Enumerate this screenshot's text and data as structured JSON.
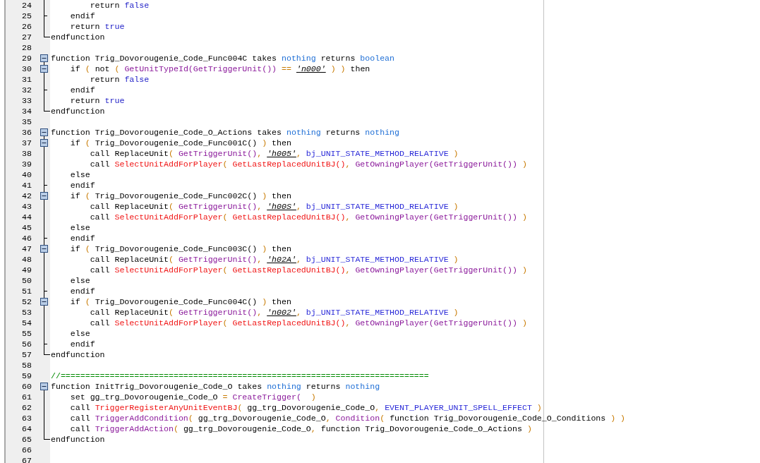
{
  "editor": {
    "lines": [
      {
        "number": "24",
        "kind": "line",
        "tokens": [
          {
            "kind": "plain",
            "text": "        return "
          },
          {
            "kind": "value",
            "text": "false"
          }
        ]
      },
      {
        "number": "25",
        "kind": "branch",
        "tokens": [
          {
            "kind": "plain",
            "text": "    endif"
          }
        ]
      },
      {
        "number": "26",
        "kind": "line",
        "tokens": [
          {
            "kind": "plain",
            "text": "    return "
          },
          {
            "kind": "value",
            "text": "true"
          }
        ]
      },
      {
        "number": "27",
        "kind": "end",
        "tokens": [
          {
            "kind": "plain",
            "text": "endfunction"
          }
        ]
      },
      {
        "number": "28",
        "kind": "none"
      },
      {
        "number": "29",
        "kind": "box",
        "tokens": [
          {
            "kind": "plain",
            "text": "function Trig_Dovorougenie_Code_Func004C takes "
          },
          {
            "kind": "type",
            "text": "nothing"
          },
          {
            "kind": "plain",
            "text": " returns "
          },
          {
            "kind": "type",
            "text": "boolean"
          }
        ]
      },
      {
        "number": "30",
        "kind": "box",
        "tokens": [
          {
            "kind": "plain",
            "text": "    if "
          },
          {
            "kind": "op",
            "text": "( "
          },
          {
            "kind": "plain",
            "text": "not "
          },
          {
            "kind": "op",
            "text": "( "
          },
          {
            "kind": "native",
            "text": "GetUnitTypeId(GetTriggerUnit())"
          },
          {
            "kind": "op",
            "text": " == "
          },
          {
            "kind": "str",
            "text": "'n000'"
          },
          {
            "kind": "op",
            "text": " ) )"
          },
          {
            "kind": "plain",
            "text": " then"
          }
        ]
      },
      {
        "number": "31",
        "kind": "line",
        "tokens": [
          {
            "kind": "plain",
            "text": "        return "
          },
          {
            "kind": "value",
            "text": "false"
          }
        ]
      },
      {
        "number": "32",
        "kind": "branch",
        "tokens": [
          {
            "kind": "plain",
            "text": "    endif"
          }
        ]
      },
      {
        "number": "33",
        "kind": "line",
        "tokens": [
          {
            "kind": "plain",
            "text": "    return "
          },
          {
            "kind": "value",
            "text": "true"
          }
        ]
      },
      {
        "number": "34",
        "kind": "end",
        "tokens": [
          {
            "kind": "plain",
            "text": "endfunction"
          }
        ]
      },
      {
        "number": "35",
        "kind": "none"
      },
      {
        "number": "36",
        "kind": "box",
        "tokens": [
          {
            "kind": "plain",
            "text": "function Trig_Dovorougenie_Code_O_Actions takes "
          },
          {
            "kind": "type",
            "text": "nothing"
          },
          {
            "kind": "plain",
            "text": " returns "
          },
          {
            "kind": "type",
            "text": "nothing"
          }
        ]
      },
      {
        "number": "37",
        "kind": "box",
        "tokens": [
          {
            "kind": "plain",
            "text": "    if "
          },
          {
            "kind": "op",
            "text": "( "
          },
          {
            "kind": "plain",
            "text": "Trig_Dovorougenie_Code_Func001C()"
          },
          {
            "kind": "op",
            "text": " )"
          },
          {
            "kind": "plain",
            "text": " then"
          }
        ]
      },
      {
        "number": "38",
        "kind": "line",
        "tokens": [
          {
            "kind": "plain",
            "text": "        call ReplaceUnit"
          },
          {
            "kind": "op",
            "text": "( "
          },
          {
            "kind": "native",
            "text": "GetTriggerUnit()"
          },
          {
            "kind": "op",
            "text": ", "
          },
          {
            "kind": "str",
            "text": "'h005'"
          },
          {
            "kind": "op",
            "text": ", "
          },
          {
            "kind": "const",
            "text": "bj_UNIT_STATE_METHOD_RELATIVE"
          },
          {
            "kind": "op",
            "text": " )"
          }
        ]
      },
      {
        "number": "39",
        "kind": "line",
        "tokens": [
          {
            "kind": "plain",
            "text": "        call "
          },
          {
            "kind": "bj",
            "text": "SelectUnitAddForPlayer"
          },
          {
            "kind": "op",
            "text": "( "
          },
          {
            "kind": "bj",
            "text": "GetLastReplacedUnitBJ()"
          },
          {
            "kind": "op",
            "text": ", "
          },
          {
            "kind": "native",
            "text": "GetOwningPlayer(GetTriggerUnit())"
          },
          {
            "kind": "op",
            "text": " )"
          }
        ]
      },
      {
        "number": "40",
        "kind": "line",
        "tokens": [
          {
            "kind": "plain",
            "text": "    else"
          }
        ]
      },
      {
        "number": "41",
        "kind": "branch",
        "tokens": [
          {
            "kind": "plain",
            "text": "    endif"
          }
        ]
      },
      {
        "number": "42",
        "kind": "box",
        "tokens": [
          {
            "kind": "plain",
            "text": "    if "
          },
          {
            "kind": "op",
            "text": "( "
          },
          {
            "kind": "plain",
            "text": "Trig_Dovorougenie_Code_Func002C()"
          },
          {
            "kind": "op",
            "text": " )"
          },
          {
            "kind": "plain",
            "text": " then"
          }
        ]
      },
      {
        "number": "43",
        "kind": "line",
        "tokens": [
          {
            "kind": "plain",
            "text": "        call ReplaceUnit"
          },
          {
            "kind": "op",
            "text": "( "
          },
          {
            "kind": "native",
            "text": "GetTriggerUnit()"
          },
          {
            "kind": "op",
            "text": ", "
          },
          {
            "kind": "str",
            "text": "'h00S'"
          },
          {
            "kind": "op",
            "text": ", "
          },
          {
            "kind": "const",
            "text": "bj_UNIT_STATE_METHOD_RELATIVE"
          },
          {
            "kind": "op",
            "text": " )"
          }
        ]
      },
      {
        "number": "44",
        "kind": "line",
        "tokens": [
          {
            "kind": "plain",
            "text": "        call "
          },
          {
            "kind": "bj",
            "text": "SelectUnitAddForPlayer"
          },
          {
            "kind": "op",
            "text": "( "
          },
          {
            "kind": "bj",
            "text": "GetLastReplacedUnitBJ()"
          },
          {
            "kind": "op",
            "text": ", "
          },
          {
            "kind": "native",
            "text": "GetOwningPlayer(GetTriggerUnit())"
          },
          {
            "kind": "op",
            "text": " )"
          }
        ]
      },
      {
        "number": "45",
        "kind": "line",
        "tokens": [
          {
            "kind": "plain",
            "text": "    else"
          }
        ]
      },
      {
        "number": "46",
        "kind": "branch",
        "tokens": [
          {
            "kind": "plain",
            "text": "    endif"
          }
        ]
      },
      {
        "number": "47",
        "kind": "box",
        "tokens": [
          {
            "kind": "plain",
            "text": "    if "
          },
          {
            "kind": "op",
            "text": "( "
          },
          {
            "kind": "plain",
            "text": "Trig_Dovorougenie_Code_Func003C()"
          },
          {
            "kind": "op",
            "text": " )"
          },
          {
            "kind": "plain",
            "text": " then"
          }
        ]
      },
      {
        "number": "48",
        "kind": "line",
        "tokens": [
          {
            "kind": "plain",
            "text": "        call ReplaceUnit"
          },
          {
            "kind": "op",
            "text": "( "
          },
          {
            "kind": "native",
            "text": "GetTriggerUnit()"
          },
          {
            "kind": "op",
            "text": ", "
          },
          {
            "kind": "str",
            "text": "'h02A'"
          },
          {
            "kind": "op",
            "text": ", "
          },
          {
            "kind": "const",
            "text": "bj_UNIT_STATE_METHOD_RELATIVE"
          },
          {
            "kind": "op",
            "text": " )"
          }
        ]
      },
      {
        "number": "49",
        "kind": "line",
        "tokens": [
          {
            "kind": "plain",
            "text": "        call "
          },
          {
            "kind": "bj",
            "text": "SelectUnitAddForPlayer"
          },
          {
            "kind": "op",
            "text": "( "
          },
          {
            "kind": "bj",
            "text": "GetLastReplacedUnitBJ()"
          },
          {
            "kind": "op",
            "text": ", "
          },
          {
            "kind": "native",
            "text": "GetOwningPlayer(GetTriggerUnit())"
          },
          {
            "kind": "op",
            "text": " )"
          }
        ]
      },
      {
        "number": "50",
        "kind": "line",
        "tokens": [
          {
            "kind": "plain",
            "text": "    else"
          }
        ]
      },
      {
        "number": "51",
        "kind": "branch",
        "tokens": [
          {
            "kind": "plain",
            "text": "    endif"
          }
        ]
      },
      {
        "number": "52",
        "kind": "box",
        "tokens": [
          {
            "kind": "plain",
            "text": "    if "
          },
          {
            "kind": "op",
            "text": "( "
          },
          {
            "kind": "plain",
            "text": "Trig_Dovorougenie_Code_Func004C()"
          },
          {
            "kind": "op",
            "text": " )"
          },
          {
            "kind": "plain",
            "text": " then"
          }
        ]
      },
      {
        "number": "53",
        "kind": "line",
        "tokens": [
          {
            "kind": "plain",
            "text": "        call ReplaceUnit"
          },
          {
            "kind": "op",
            "text": "( "
          },
          {
            "kind": "native",
            "text": "GetTriggerUnit()"
          },
          {
            "kind": "op",
            "text": ", "
          },
          {
            "kind": "str",
            "text": "'n002'"
          },
          {
            "kind": "op",
            "text": ", "
          },
          {
            "kind": "const",
            "text": "bj_UNIT_STATE_METHOD_RELATIVE"
          },
          {
            "kind": "op",
            "text": " )"
          }
        ]
      },
      {
        "number": "54",
        "kind": "line",
        "tokens": [
          {
            "kind": "plain",
            "text": "        call "
          },
          {
            "kind": "bj",
            "text": "SelectUnitAddForPlayer"
          },
          {
            "kind": "op",
            "text": "( "
          },
          {
            "kind": "bj",
            "text": "GetLastReplacedUnitBJ()"
          },
          {
            "kind": "op",
            "text": ", "
          },
          {
            "kind": "native",
            "text": "GetOwningPlayer(GetTriggerUnit())"
          },
          {
            "kind": "op",
            "text": " )"
          }
        ]
      },
      {
        "number": "55",
        "kind": "line",
        "tokens": [
          {
            "kind": "plain",
            "text": "    else"
          }
        ]
      },
      {
        "number": "56",
        "kind": "branch",
        "tokens": [
          {
            "kind": "plain",
            "text": "    endif"
          }
        ]
      },
      {
        "number": "57",
        "kind": "end",
        "tokens": [
          {
            "kind": "plain",
            "text": "endfunction"
          }
        ]
      },
      {
        "number": "58",
        "kind": "none"
      },
      {
        "number": "59",
        "kind": "none",
        "tokens": [
          {
            "kind": "comment",
            "text": "//==========================================================================="
          }
        ]
      },
      {
        "number": "60",
        "kind": "box",
        "tokens": [
          {
            "kind": "plain",
            "text": "function InitTrig_Dovorougenie_Code_O takes "
          },
          {
            "kind": "type",
            "text": "nothing"
          },
          {
            "kind": "plain",
            "text": " returns "
          },
          {
            "kind": "type",
            "text": "nothing"
          }
        ]
      },
      {
        "number": "61",
        "kind": "line",
        "tokens": [
          {
            "kind": "plain",
            "text": "    set gg_trg_Dovorougenie_Code_O "
          },
          {
            "kind": "op",
            "text": "= "
          },
          {
            "kind": "native",
            "text": "CreateTrigger(  "
          },
          {
            "kind": "op",
            "text": ")"
          }
        ]
      },
      {
        "number": "62",
        "kind": "line",
        "tokens": [
          {
            "kind": "plain",
            "text": "    call "
          },
          {
            "kind": "bj",
            "text": "TriggerRegisterAnyUnitEventBJ"
          },
          {
            "kind": "op",
            "text": "( "
          },
          {
            "kind": "plain",
            "text": "gg_trg_Dovorougenie_Code_O"
          },
          {
            "kind": "op",
            "text": ", "
          },
          {
            "kind": "const",
            "text": "EVENT_PLAYER_UNIT_SPELL_EFFECT"
          },
          {
            "kind": "op",
            "text": " )"
          }
        ]
      },
      {
        "number": "63",
        "kind": "line",
        "tokens": [
          {
            "kind": "plain",
            "text": "    call "
          },
          {
            "kind": "native",
            "text": "TriggerAddCondition"
          },
          {
            "kind": "op",
            "text": "( "
          },
          {
            "kind": "plain",
            "text": "gg_trg_Dovorougenie_Code_O"
          },
          {
            "kind": "op",
            "text": ", "
          },
          {
            "kind": "native",
            "text": "Condition"
          },
          {
            "kind": "op",
            "text": "( "
          },
          {
            "kind": "plain",
            "text": "function Trig_Dovorougenie_Code_O_Conditions"
          },
          {
            "kind": "op",
            "text": " ) )"
          }
        ]
      },
      {
        "number": "64",
        "kind": "line",
        "tokens": [
          {
            "kind": "plain",
            "text": "    call "
          },
          {
            "kind": "native",
            "text": "TriggerAddAction"
          },
          {
            "kind": "op",
            "text": "( "
          },
          {
            "kind": "plain",
            "text": "gg_trg_Dovorougenie_Code_O"
          },
          {
            "kind": "op",
            "text": ", "
          },
          {
            "kind": "plain",
            "text": "function Trig_Dovorougenie_Code_O_Actions"
          },
          {
            "kind": "op",
            "text": " )"
          }
        ]
      },
      {
        "number": "65",
        "kind": "end",
        "tokens": [
          {
            "kind": "plain",
            "text": "endfunction"
          }
        ]
      },
      {
        "number": "66",
        "kind": "none"
      },
      {
        "number": "67",
        "kind": "none"
      }
    ]
  }
}
